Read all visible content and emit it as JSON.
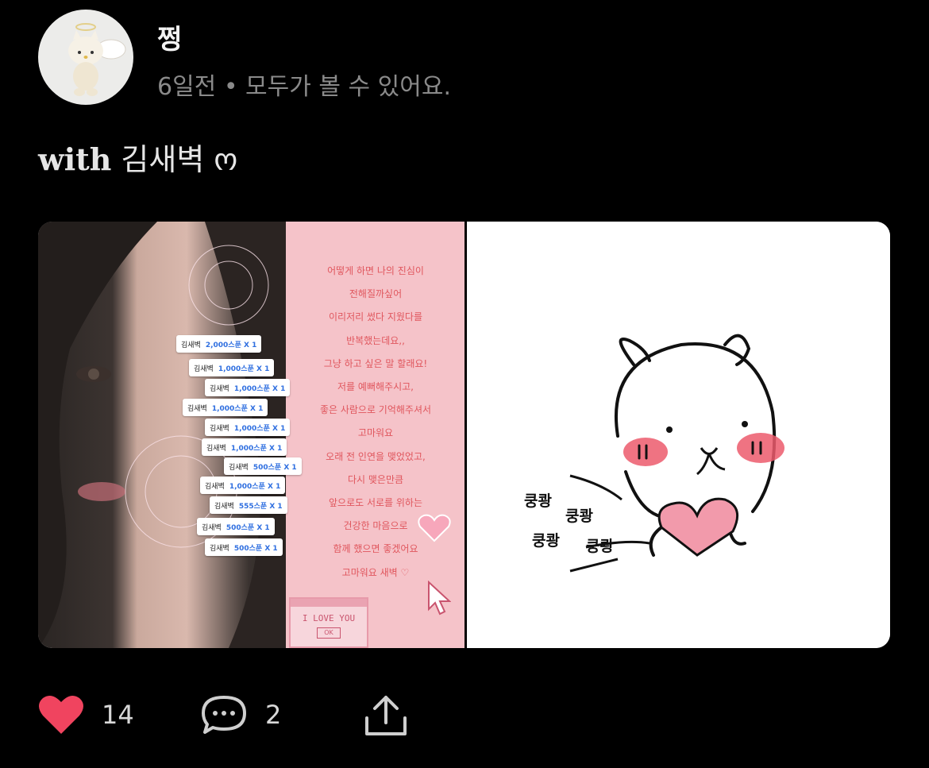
{
  "post": {
    "author": "쩡",
    "meta": "6일전 • 모두가 볼 수 있어요.",
    "caption_with": "with",
    "caption_name": "김새벽",
    "caption_emoji": "ო"
  },
  "image_left": {
    "donations": [
      {
        "name": "김새벽",
        "item": "2,000스푼 X 1"
      },
      {
        "name": "김새벽",
        "item": "1,000스푼 X 1"
      },
      {
        "name": "김새벽",
        "item": "1,000스푼 X 1"
      },
      {
        "name": "김새벽",
        "item": "1,000스푼 X 1"
      },
      {
        "name": "김새벽",
        "item": "1,000스푼 X 1"
      },
      {
        "name": "김새벽",
        "item": "1,000스푼 X 1"
      },
      {
        "name": "김새벽",
        "item": "500스푼 X 1"
      },
      {
        "name": "김새벽",
        "item": "1,000스푼 X 1"
      },
      {
        "name": "김새벽",
        "item": "555스푼 X 1"
      },
      {
        "name": "김새벽",
        "item": "500스푼 X 1"
      },
      {
        "name": "김새벽",
        "item": "500스푼 X 1"
      }
    ],
    "letter_lines": [
      "어떻게 하면 나의 진심이",
      "전해질까싶어",
      "이리저리 썼다 지웠다를",
      "반복했는데요,,",
      "그냥 하고 싶은 말 할래요!",
      "저를 예뻐해주시고,",
      "좋은 사람으로 기억해주셔서",
      "고마워요",
      "오래 전 인연을 맺었었고,",
      "다시 맺은만큼",
      "앞으로도 서로를 위하는",
      "건강한 마음으로",
      "함께 했으면 좋겠어요",
      "고마워요 새벽 ♡"
    ],
    "love_you_text": "I LOVE YOU",
    "ok_text": "OK"
  },
  "image_right": {
    "sfx": [
      "쿵쾅",
      "쿵쾅",
      "쿵쾅",
      "쿵쾅"
    ]
  },
  "actions": {
    "like_count": "14",
    "comment_count": "2",
    "like_color": "#f0445f"
  }
}
